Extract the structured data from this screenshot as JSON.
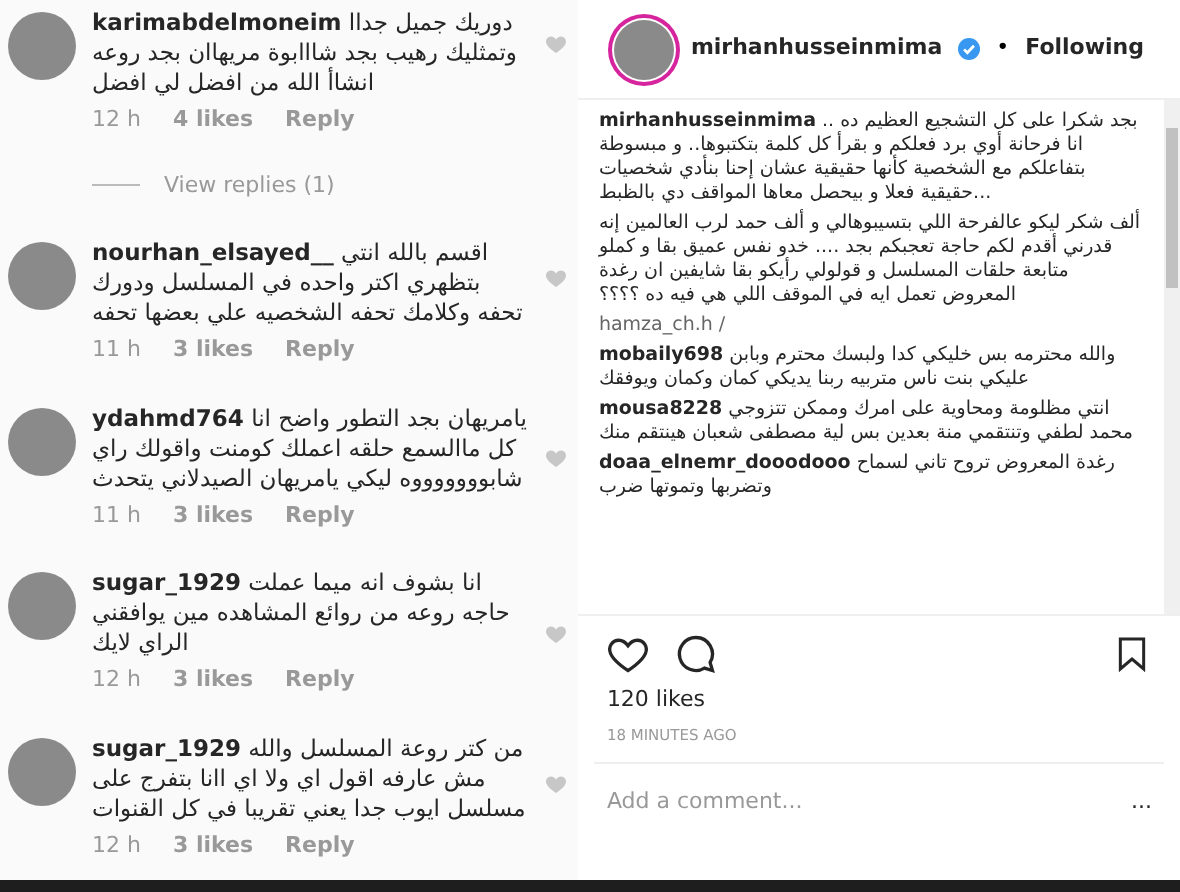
{
  "comments": [
    {
      "username": "karimabdelmoneim",
      "text": "دوريك جميل جداا وتمثليك رهيب بجد شااابوة مريهاان بجد روعه انشاأ الله من افضل لي افضل",
      "time": "12 h",
      "likes": "4 likes",
      "reply": "Reply",
      "view_replies": "View replies (1)"
    },
    {
      "username": "nourhan_elsayed__",
      "text": "اقسم بالله انتي بتظهري اكتر واحده في المسلسل ودورك تحفه وكلامك تحفه الشخصيه علي بعضها تحفه",
      "time": "11 h",
      "likes": "3 likes",
      "reply": "Reply"
    },
    {
      "username": "ydahmd764",
      "text": "يامريهان بجد التطور واضح انا كل ماالسمع حلقه اعملك كومنت واقولك راي شابوووووووه ليكي يامريهان الصيدلاني يتحدث",
      "time": "11 h",
      "likes": "3 likes",
      "reply": "Reply"
    },
    {
      "username": "sugar_1929",
      "text": "انا بشوف انه ميما عملت حاجه روعه من روائع المشاهده مين يوافقني الراي لايك",
      "time": "12 h",
      "likes": "3 likes",
      "reply": "Reply"
    },
    {
      "username": "sugar_1929",
      "text": "من كتر روعة المسلسل والله مش عارفه اقول اي ولا اي اانا بتفرج على مسلسل ايوب جدا يعني تقريبا في كل القنوات",
      "time": "12 h",
      "likes": "3 likes",
      "reply": "Reply"
    }
  ],
  "post": {
    "username": "mirhanhusseinmima",
    "separator": "•",
    "follow": "Following",
    "caption": {
      "username": "mirhanhusseinmima",
      "paragraphs": [
        "بجد شكرا على كل التشجيع العظيم ده .. انا فرحانة أوي برد فعلكم و بقرأ كل كلمة بتكتبوها.. و مبسوطة بتفاعلكم مع الشخصية كأنها حقيقية عشان إحنا بنأدي شخصيات حقيقية فعلا و بيحصل معاها المواقف دي بالظبط...",
        "ألف شكر ليكو عالفرحة اللي بتسيبوهالي و ألف حمد لرب العالمين إنه قدرني أقدم لكم حاجة تعجبكم بجد .... خدو نفس عميق بقا و كملو متابعة حلقات المسلسل و قولولي رأيكو بقا شايفين ان رغدة المعروض تعمل ايه في الموقف اللي هي فيه ده ؟؟؟؟"
      ]
    },
    "mention": "hamza_ch.h /",
    "comments": [
      {
        "username": "mobaily698",
        "text": "والله محترمه بس خليكي كدا ولبسك محترم وبابن عليكي بنت ناس متربيه ربنا يديكي كمان وكمان ويوفقك"
      },
      {
        "username": "mousa8228",
        "text": "انتي مظلومة ومحاوية على امرك وممكن تتزوجي محمد لطفي وتنتقمي منة بعدين بس لية مصطفى شعبان هينتقم منك"
      },
      {
        "username": "doaa_elnemr_dooodooo",
        "text": "رغدة المعروض تروح تاني لسماح وتضربها وتموتها ضرب"
      }
    ],
    "likes": "120 likes",
    "time": "18 MINUTES AGO",
    "comment_placeholder": "Add a comment...",
    "more": "..."
  }
}
